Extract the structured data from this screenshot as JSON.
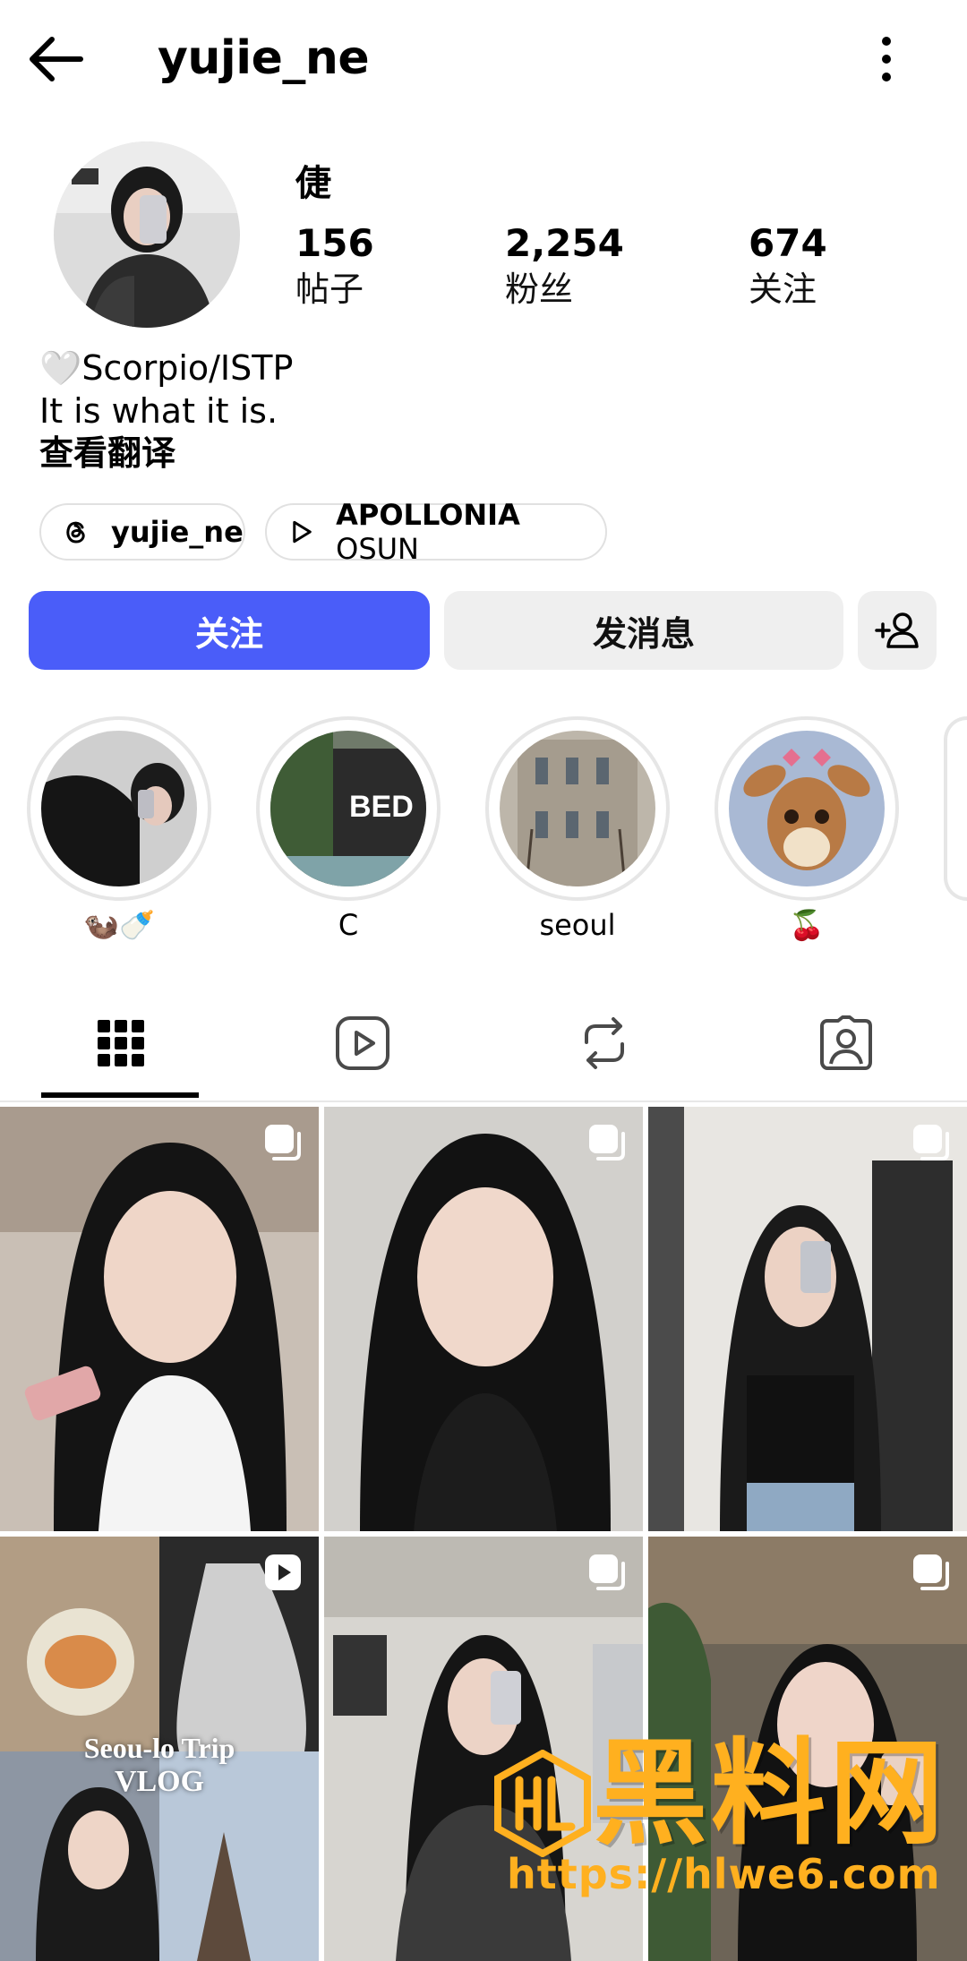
{
  "header": {
    "username": "yujie_ne",
    "back_icon": "arrow-left-icon",
    "menu_icon": "more-vertical-icon"
  },
  "profile": {
    "display_name": "倢",
    "stats": {
      "posts": {
        "value": "156",
        "label": "帖子"
      },
      "followers": {
        "value": "2,254",
        "label": "粉丝"
      },
      "following": {
        "value": "674",
        "label": "关注"
      }
    },
    "bio_line1": "🤍Scorpio/ISTP",
    "bio_line2": "It is what it is.",
    "translate_label": "查看翻译"
  },
  "chips": {
    "threads": {
      "icon": "threads-icon",
      "label": "yujie_ne"
    },
    "music": {
      "icon": "play-icon",
      "label_bold": "APOLLONIA",
      "label_rest": " OSUN"
    }
  },
  "actions": {
    "follow_label": "关注",
    "message_label": "发消息",
    "add_user_icon": "add-user-icon"
  },
  "highlights": [
    {
      "label": "🦦🍼"
    },
    {
      "label": "C",
      "image_text": "BED"
    },
    {
      "label": "seoul"
    },
    {
      "label": "🍒"
    }
  ],
  "tabs": [
    {
      "name": "posts",
      "icon": "grid-icon",
      "active": true
    },
    {
      "name": "reels",
      "icon": "reels-icon",
      "active": false
    },
    {
      "name": "reposts",
      "icon": "repost-icon",
      "active": false
    },
    {
      "name": "tagged",
      "icon": "tagged-icon",
      "active": false
    }
  ],
  "grid_overlay_text": {
    "line1": "Seou-lo Trip",
    "line2": "VLOG"
  },
  "watermark": {
    "text": "黑料网",
    "url": "https://hlwe6.com"
  },
  "colors": {
    "accent": "#4a5df9",
    "secondary_button": "#efefef",
    "watermark": "#ffb01f"
  }
}
